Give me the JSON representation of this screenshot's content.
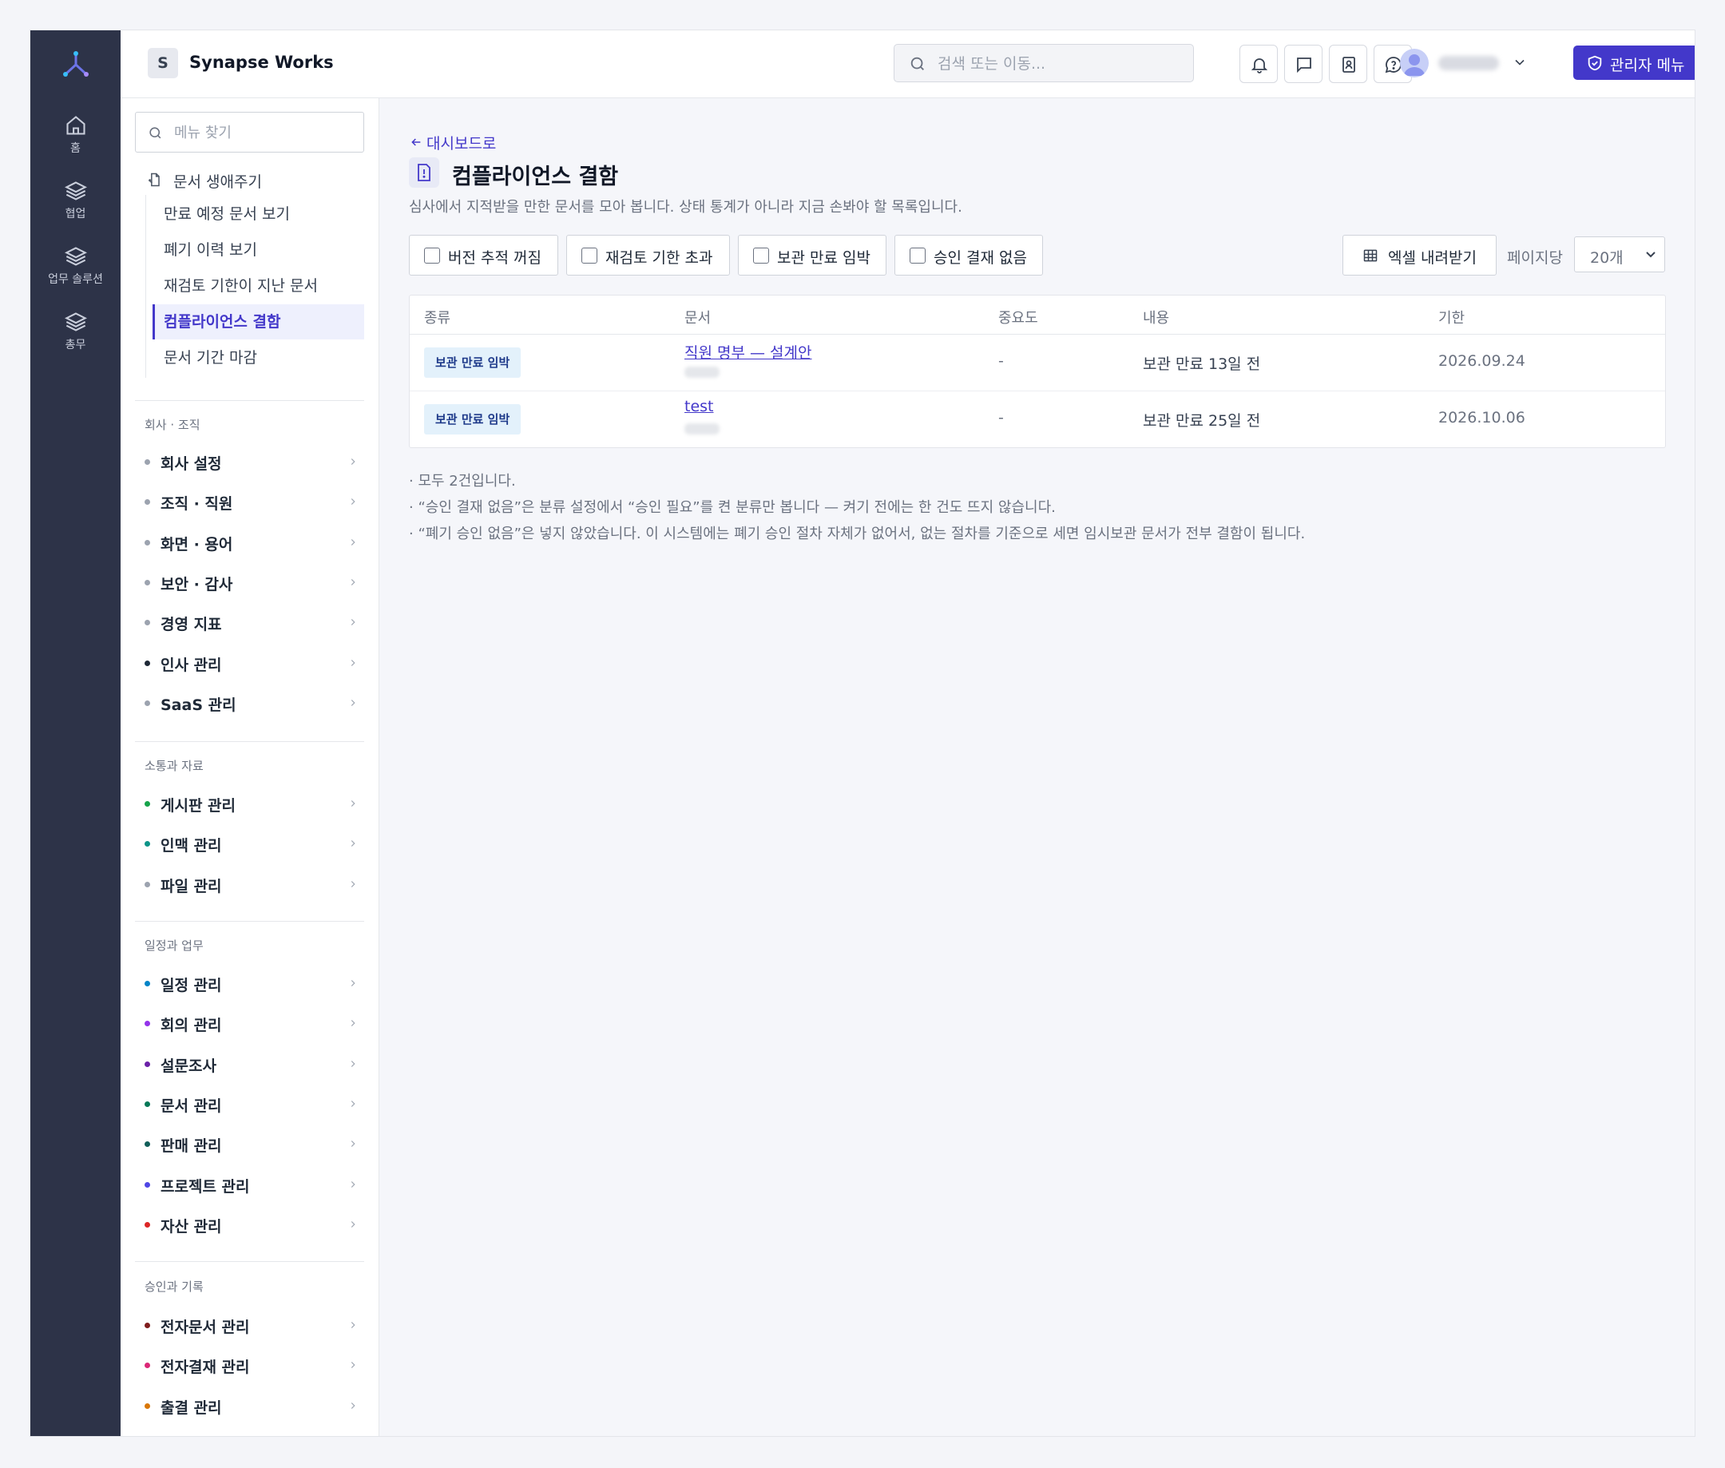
{
  "rail": {
    "items": [
      {
        "label": "홈",
        "icon": "home-icon"
      },
      {
        "label": "협업",
        "icon": "layers-icon"
      },
      {
        "label": "업무 솔루션",
        "icon": "layers-icon"
      },
      {
        "label": "총무",
        "icon": "layers-icon"
      }
    ]
  },
  "topbar": {
    "workspace_initial": "S",
    "workspace_name": "Synapse Works",
    "search_placeholder": "검색 또는 이동...",
    "admin_label": "관리자 메뉴"
  },
  "menu": {
    "search_placeholder": "메뉴 찾기",
    "lifecycle_title": "문서 생애주기",
    "lifecycle_items": [
      "만료 예정 문서 보기",
      "폐기 이력 보기",
      "재검토 기한이 지난 문서",
      "컴플라이언스 결함",
      "문서 기간 마감"
    ],
    "sections": [
      {
        "title": "회사 · 조직",
        "items": [
          {
            "label": "회사 설정",
            "color": "#9ca3af"
          },
          {
            "label": "조직 · 직원",
            "color": "#9ca3af"
          },
          {
            "label": "화면 · 용어",
            "color": "#9ca3af"
          },
          {
            "label": "보안 · 감사",
            "color": "#9ca3af"
          },
          {
            "label": "경영 지표",
            "color": "#9ca3af"
          },
          {
            "label": "인사 관리",
            "color": "#1f2937"
          },
          {
            "label": "SaaS 관리",
            "color": "#9ca3af"
          }
        ]
      },
      {
        "title": "소통과 자료",
        "items": [
          {
            "label": "게시판 관리",
            "color": "#16a34a"
          },
          {
            "label": "인맥 관리",
            "color": "#0d9488"
          },
          {
            "label": "파일 관리",
            "color": "#9ca3af"
          }
        ]
      },
      {
        "title": "일정과 업무",
        "items": [
          {
            "label": "일정 관리",
            "color": "#0284c7"
          },
          {
            "label": "회의 관리",
            "color": "#9333ea"
          },
          {
            "label": "설문조사",
            "color": "#6b21a8"
          },
          {
            "label": "문서 관리",
            "color": "#047857"
          },
          {
            "label": "판매 관리",
            "color": "#115e59"
          },
          {
            "label": "프로젝트 관리",
            "color": "#4f46e5"
          },
          {
            "label": "자산 관리",
            "color": "#dc2626"
          }
        ]
      },
      {
        "title": "승인과 기록",
        "items": [
          {
            "label": "전자문서 관리",
            "color": "#7f1d1d"
          },
          {
            "label": "전자결재 관리",
            "color": "#db2777"
          },
          {
            "label": "출결 관리",
            "color": "#d97706"
          }
        ]
      }
    ]
  },
  "main": {
    "back_label": "대시보드로",
    "title": "컴플라이언스 결함",
    "description": "심사에서 지적받을 만한 문서를 모아 봅니다. 상태 통계가 아니라 지금 손봐야 할 목록입니다.",
    "filters": [
      "버전 추적 꺼짐",
      "재검토 기한 초과",
      "보관 만료 임박",
      "승인 결재 없음"
    ],
    "excel_label": "엑셀 내려받기",
    "per_page_label": "페이지당",
    "page_size": "20개",
    "columns": [
      "종류",
      "문서",
      "중요도",
      "내용",
      "기한"
    ],
    "rows": [
      {
        "type": "보관 만료 임박",
        "doc": "직원 명부 — 설계안",
        "importance": "-",
        "content": "보관 만료 13일 전",
        "due": "2026.09.24"
      },
      {
        "type": "보관 만료 임박",
        "doc": "test",
        "importance": "-",
        "content": "보관 만료 25일 전",
        "due": "2026.10.06"
      }
    ],
    "notes": [
      "· 모두 2건입니다.",
      "· “승인 결재 없음”은 분류 설정에서 “승인 필요”를 켠 분류만 봅니다 — 켜기 전에는 한 건도 뜨지 않습니다.",
      "· “폐기 승인 없음”은 넣지 않았습니다. 이 시스템에는 폐기 승인 절차 자체가 없어서, 없는 절차를 기준으로 세면 임시보관 문서가 전부 결함이 됩니다."
    ]
  },
  "colors": {
    "accent": "#4338ca",
    "rail_bg": "#2d3348",
    "badge_bg": "#e3f1fb"
  }
}
